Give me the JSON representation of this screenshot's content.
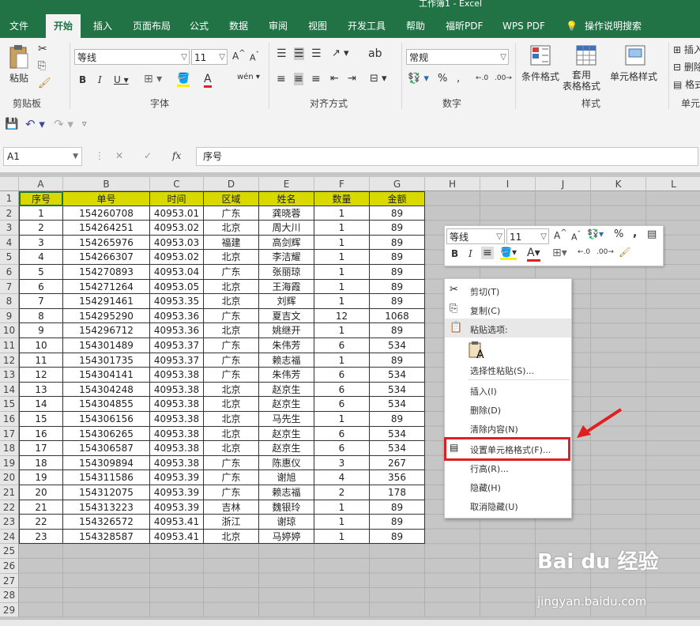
{
  "window": {
    "title": "工作簿1 - Excel"
  },
  "tabs": [
    "文件",
    "开始",
    "插入",
    "页面布局",
    "公式",
    "数据",
    "审阅",
    "视图",
    "开发工具",
    "帮助",
    "福昕PDF",
    "WPS PDF",
    "操作说明搜索"
  ],
  "ribbon": {
    "paste_label": "粘贴",
    "font_name": "等线",
    "font_size": "11",
    "number_format": "常规",
    "cond_format": "条件格式",
    "table_format": "套用\n表格格式",
    "cell_style": "单元格样式",
    "insert": "插入",
    "delete": "删除",
    "format": "格式",
    "groups": {
      "clipboard": "剪贴板",
      "font": "字体",
      "alignment": "对齐方式",
      "number": "数字",
      "styles": "样式",
      "cells": "单元"
    }
  },
  "formula_bar": {
    "name_box": "A1",
    "content": "序号"
  },
  "columns": [
    "A",
    "B",
    "C",
    "D",
    "E",
    "F",
    "G",
    "H",
    "I",
    "J",
    "K",
    "L"
  ],
  "table": {
    "headers": [
      "序号",
      "单号",
      "时间",
      "区域",
      "姓名",
      "数量",
      "金额"
    ],
    "rows": [
      [
        "1",
        "154260708",
        "40953.01",
        "广东",
        "龚晓蓉",
        "1",
        "89"
      ],
      [
        "2",
        "154264251",
        "40953.02",
        "北京",
        "周大川",
        "1",
        "89"
      ],
      [
        "3",
        "154265976",
        "40953.03",
        "福建",
        "高剑辉",
        "1",
        "89"
      ],
      [
        "4",
        "154266307",
        "40953.02",
        "北京",
        "李洁耀",
        "1",
        "89"
      ],
      [
        "5",
        "154270893",
        "40953.04",
        "广东",
        "张丽琼",
        "1",
        "89"
      ],
      [
        "6",
        "154271264",
        "40953.05",
        "北京",
        "王海霞",
        "1",
        "89"
      ],
      [
        "7",
        "154291461",
        "40953.35",
        "北京",
        "刘辉",
        "1",
        "89"
      ],
      [
        "8",
        "154295290",
        "40953.36",
        "广东",
        "夏吉文",
        "12",
        "1068"
      ],
      [
        "9",
        "154296712",
        "40953.36",
        "北京",
        "姚继开",
        "1",
        "89"
      ],
      [
        "10",
        "154301489",
        "40953.37",
        "广东",
        "朱伟芳",
        "6",
        "534"
      ],
      [
        "11",
        "154301735",
        "40953.37",
        "广东",
        "赖志福",
        "1",
        "89"
      ],
      [
        "12",
        "154304141",
        "40953.38",
        "广东",
        "朱伟芳",
        "6",
        "534"
      ],
      [
        "13",
        "154304248",
        "40953.38",
        "北京",
        "赵京生",
        "6",
        "534"
      ],
      [
        "14",
        "154304855",
        "40953.38",
        "北京",
        "赵京生",
        "6",
        "534"
      ],
      [
        "15",
        "154306156",
        "40953.38",
        "北京",
        "马先生",
        "1",
        "89"
      ],
      [
        "16",
        "154306265",
        "40953.38",
        "北京",
        "赵京生",
        "6",
        "534"
      ],
      [
        "17",
        "154306587",
        "40953.38",
        "北京",
        "赵京生",
        "6",
        "534"
      ],
      [
        "18",
        "154309894",
        "40953.38",
        "广东",
        "陈惠仪",
        "3",
        "267"
      ],
      [
        "19",
        "154311586",
        "40953.39",
        "广东",
        "谢旭",
        "4",
        "356"
      ],
      [
        "20",
        "154312075",
        "40953.39",
        "广东",
        "赖志福",
        "2",
        "178"
      ],
      [
        "21",
        "154313223",
        "40953.39",
        "吉林",
        "魏银玲",
        "1",
        "89"
      ],
      [
        "22",
        "154326572",
        "40953.41",
        "浙江",
        "谢琼",
        "1",
        "89"
      ],
      [
        "23",
        "154328587",
        "40953.41",
        "北京",
        "马婷婷",
        "1",
        "89"
      ]
    ]
  },
  "row_numbers": [
    "1",
    "2",
    "3",
    "4",
    "5",
    "6",
    "7",
    "8",
    "9",
    "10",
    "11",
    "12",
    "13",
    "14",
    "15",
    "16",
    "17",
    "18",
    "19",
    "20",
    "21",
    "22",
    "23",
    "24",
    "25",
    "26",
    "27",
    "28",
    "29"
  ],
  "mini_toolbar": {
    "font_name": "等线",
    "font_size": "11"
  },
  "context_menu": [
    "剪切(T)",
    "复制(C)",
    "粘贴选项:",
    "选择性粘贴(S)...",
    "插入(I)",
    "删除(D)",
    "清除内容(N)",
    "设置单元格格式(F)...",
    "行高(R)...",
    "隐藏(H)",
    "取消隐藏(U)"
  ],
  "watermark": {
    "brand": "Bai du 经验",
    "url": "jingyan.baidu.com"
  },
  "colors": {
    "excel_green": "#217346",
    "header_fill": "#d9d900",
    "highlight": "#e02020"
  }
}
